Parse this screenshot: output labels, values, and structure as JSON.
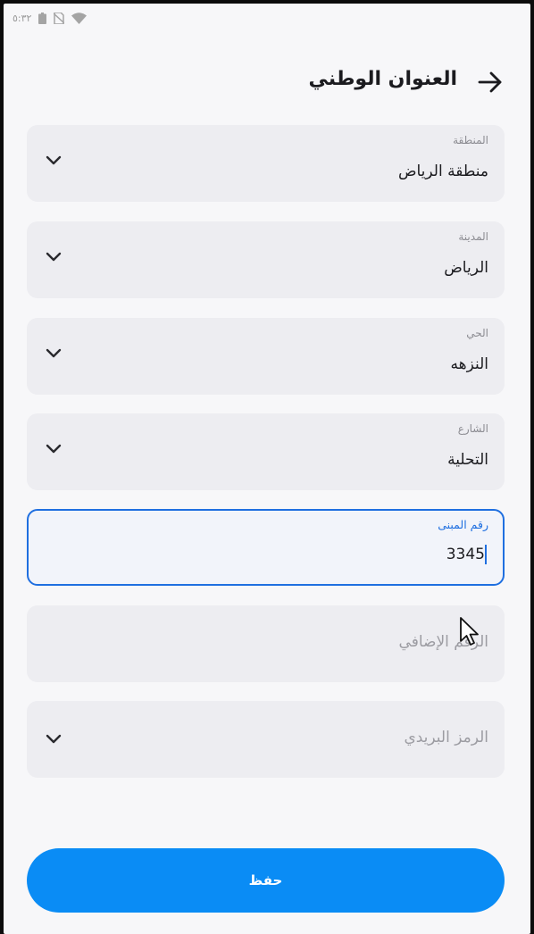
{
  "status_bar": {
    "time": "٥:٣٢",
    "icons": [
      "battery-icon",
      "no-sim-icon",
      "wifi-icon"
    ]
  },
  "header": {
    "title": "العنوان الوطني",
    "back_icon": "arrow-right-icon"
  },
  "fields": [
    {
      "label": "المنطقة",
      "value": "منطقة الرياض",
      "type": "dropdown"
    },
    {
      "label": "المدينة",
      "value": "الرياض",
      "type": "dropdown"
    },
    {
      "label": "الحي",
      "value": "النزهه",
      "type": "dropdown"
    },
    {
      "label": "الشارع",
      "value": "التحلية",
      "type": "dropdown"
    },
    {
      "label": "رقم المبنى",
      "value": "3345",
      "type": "text",
      "focused": true
    },
    {
      "placeholder": "الرقم الإضافي",
      "type": "text"
    },
    {
      "placeholder": "الرمز البريدي",
      "type": "dropdown"
    }
  ],
  "save_button": {
    "label": "حفظ"
  },
  "colors": {
    "accent": "#0a8cf5",
    "focus_border": "#1f6fe0",
    "field_background": "#ededf1",
    "page_background": "#f7f7f9"
  }
}
